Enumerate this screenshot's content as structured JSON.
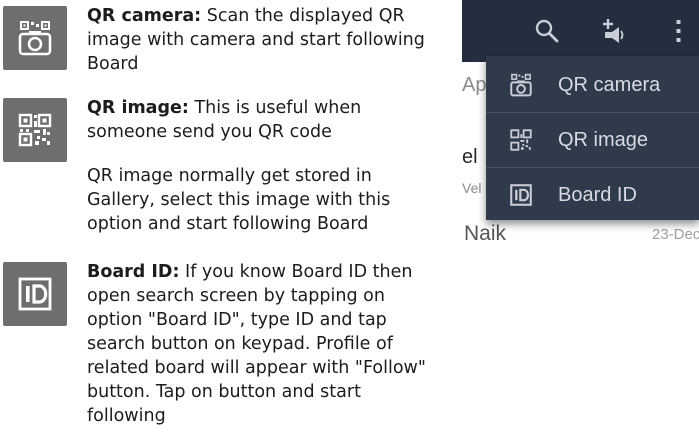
{
  "help": {
    "qr_camera": {
      "title": "QR camera:",
      "text": " Scan the displayed QR image with camera and start following Board",
      "icon": "qr-camera-icon"
    },
    "qr_image": {
      "title": "QR image:",
      "text": " This is useful when someone send you QR code",
      "note": "QR image normally get stored in Gallery, select this image with this option and start following Board",
      "icon": "qr-image-icon"
    },
    "board_id": {
      "title": "Board ID:",
      "text": " If you know Board ID then open search screen by tapping on option \"Board ID\",  type ID and tap search button on keypad. Profile of related board will appear with \"Follow\" button. Tap on button and start following",
      "icon": "id-icon"
    }
  },
  "phone": {
    "toolbar_icons": [
      "search-icon",
      "add-announce-icon",
      "overflow-menu-icon"
    ],
    "menu": {
      "items": [
        {
          "label": "QR camera",
          "icon": "qr-camera-icon"
        },
        {
          "label": "QR image",
          "icon": "qr-image-icon"
        },
        {
          "label": "Board ID",
          "icon": "id-icon"
        }
      ]
    },
    "background": {
      "fragment_1": "Ap",
      "fragment_2": "el",
      "fragment_3": "Vel",
      "name": "Naik",
      "date": "23-Dec"
    }
  },
  "colors": {
    "appbar": "#232e3f",
    "menu": "#2f3a4a",
    "doc_icon_bg": "#6e6e6e"
  }
}
